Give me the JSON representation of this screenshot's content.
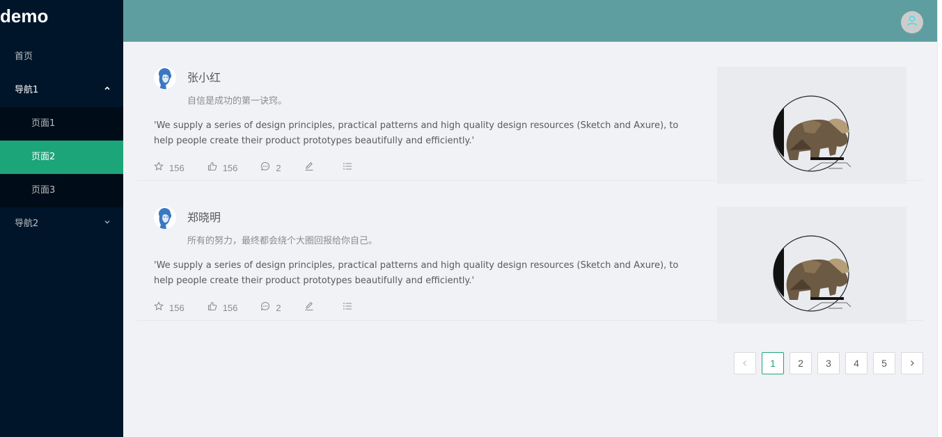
{
  "app": {
    "logo": "demo"
  },
  "menu": {
    "home": "首页",
    "nav1": {
      "label": "导航1",
      "items": [
        "页面1",
        "页面2",
        "页面3"
      ]
    },
    "nav2": {
      "label": "导航2"
    }
  },
  "list": [
    {
      "title": "张小红",
      "description": "自信是成功的第一诀窍。",
      "content": "'We supply a series of design principles, practical patterns and high quality design resources (Sketch and Axure), to help people create their product prototypes beautifully and efficiently.'",
      "stars": "156",
      "likes": "156",
      "comments": "2",
      "cover_text": "GRIZZLY BEAR"
    },
    {
      "title": "郑晓明",
      "description": "所有的努力，最终都会绕个大圈回报给你自己。",
      "content": "'We supply a series of design principles, practical patterns and high quality design resources (Sketch and Axure), to help people create their product prototypes beautifully and efficiently.'",
      "stars": "156",
      "likes": "156",
      "comments": "2",
      "cover_text": "GRIZZLY BEAR"
    }
  ],
  "pagination": {
    "pages": [
      "1",
      "2",
      "3",
      "4",
      "5"
    ],
    "current": "1"
  },
  "colors": {
    "sider": "#001529",
    "header": "#5f9ea0",
    "accent": "#1da57a"
  }
}
